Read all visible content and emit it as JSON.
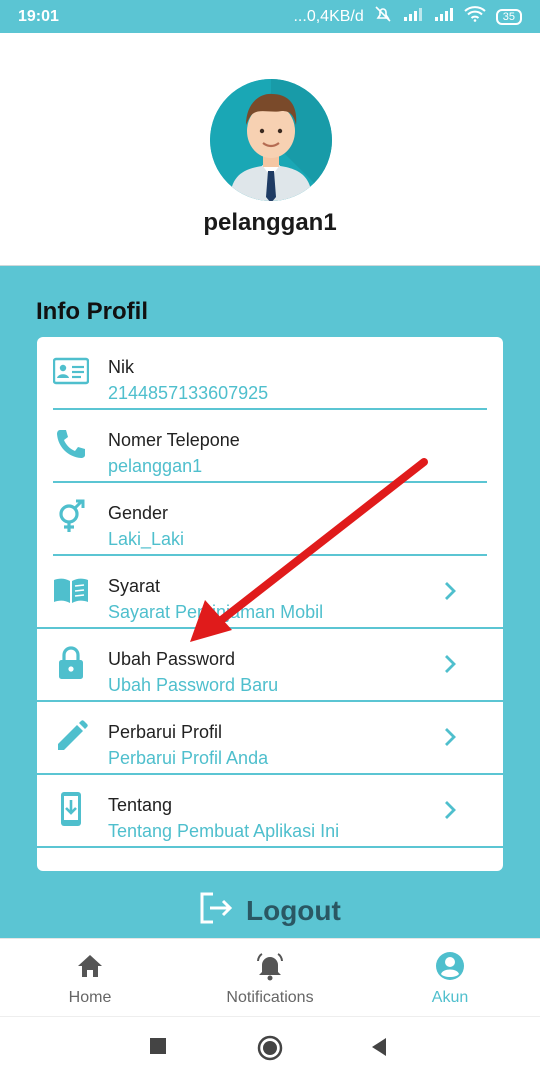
{
  "status_bar": {
    "time": "19:01",
    "network_speed": "...0,4KB/d",
    "battery": "35",
    "icons": [
      "mute-icon",
      "4g-signal-icon",
      "signal-icon",
      "wifi-icon",
      "battery-icon"
    ]
  },
  "profile": {
    "username": "pelanggan1",
    "avatar_icon": "user-avatar-icon"
  },
  "info": {
    "title": "Info Profil",
    "rows": [
      {
        "label": "Nik",
        "value": "2144857133607925",
        "icon": "id-card-icon"
      },
      {
        "label": "Nomer Telepone",
        "value": "pelanggan1",
        "icon": "phone-icon"
      },
      {
        "label": "Gender",
        "value": "Laki_Laki",
        "icon": "gender-icon"
      },
      {
        "label": "Syarat",
        "value": "Sayarat Peminjaman Mobil",
        "icon": "book-icon"
      },
      {
        "label": "Ubah Password",
        "value": "Ubah Password Baru",
        "icon": "lock-icon"
      },
      {
        "label": "Perbarui Profil",
        "value": "Perbarui Profil Anda",
        "icon": "pencil-icon"
      },
      {
        "label": "Tentang",
        "value": "Tentang Pembuat Aplikasi Ini",
        "icon": "phone-download-icon"
      }
    ]
  },
  "logout": {
    "label": "Logout"
  },
  "bottom_nav": {
    "items": [
      {
        "label": "Home",
        "icon": "home-icon"
      },
      {
        "label": "Notifications",
        "icon": "bell-icon"
      },
      {
        "label": "Akun",
        "icon": "account-icon"
      }
    ],
    "active": "Akun"
  },
  "colors": {
    "accent": "#5bc5d3",
    "accent_text": "#4fbfcd",
    "logout_text": "#2a5763",
    "annotation_arrow": "#e01b1b"
  }
}
